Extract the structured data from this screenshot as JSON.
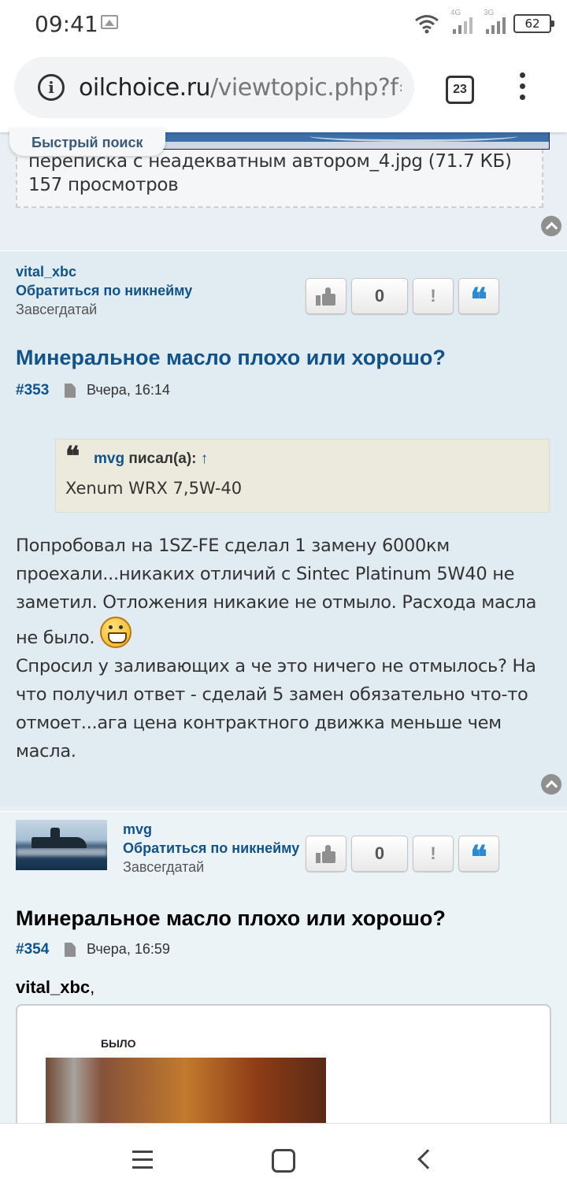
{
  "status_bar": {
    "time": "09:41",
    "net_labels": [
      "4G",
      "3G"
    ],
    "battery": "62"
  },
  "browser": {
    "url_domain": "oilchoice.ru",
    "url_path": "/viewtopic.php?f=",
    "tab_count": "23"
  },
  "quick_search": "Быстрый поиск",
  "attachment": {
    "filename": "переписка с неадекватным автором_4.jpg (71.7 КБ)",
    "views": "157 просмотров"
  },
  "posts": [
    {
      "author": "vital_xbc",
      "nick_link": "Обратиться по никнейму",
      "rank": "Завсегдатай",
      "rating": "0",
      "report_label": "!",
      "title": "Минеральное масло плохо или хорошо?",
      "number": "#353",
      "date": "Вчера, 16:14",
      "quote": {
        "author": "mvg",
        "wrote": "писал(а):",
        "arrow": "↑",
        "text": "Xenum WRX 7,5W-40"
      },
      "body_1": "Попробовал на 1SZ-FE сделал 1 замену 6000км проехали...никаких отличий с Sintec Platinum 5W40 не заметил. Отложения никакие не отмыло. Расхода масла не было.",
      "body_2": "Спросил у заливающих а че это ничего не отмылось? На что получил ответ - сделай 5 замен обязательно что-то отмоет...ага цена контрактного движка меньше чем масла."
    },
    {
      "author": "mvg",
      "nick_link": "Обратиться по никнейму",
      "rank": "Завсегдатай",
      "rating": "0",
      "report_label": "!",
      "title": "Минеральное масло плохо или хорошо?",
      "number": "#354",
      "date": "Вчера, 16:59",
      "reply_to": "vital_xbc",
      "reply_suffix": ",",
      "image_caption": "БЫЛО"
    }
  ],
  "colors": {
    "link": "#105289",
    "quote_icon": "#2b8ad0",
    "post_bg": "#e1ebf2",
    "quote_bg": "#ebeadd"
  }
}
